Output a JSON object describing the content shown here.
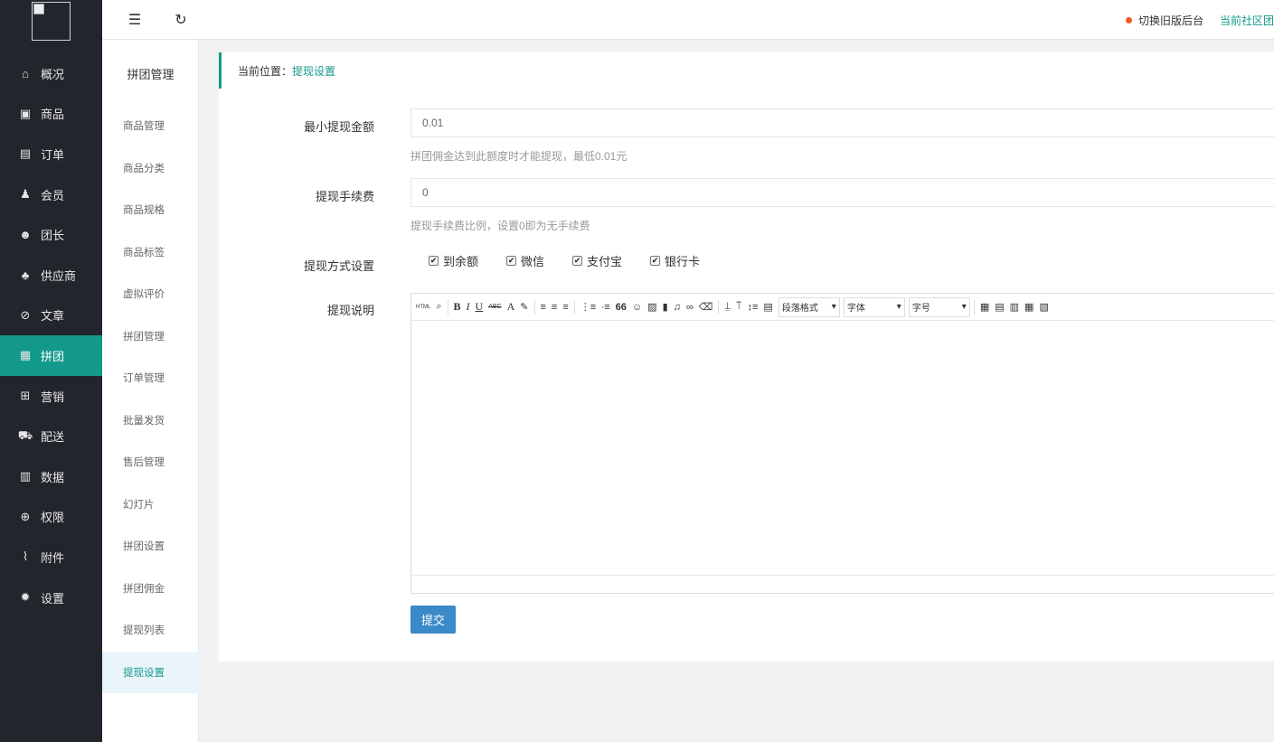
{
  "sidebar": {
    "items": [
      {
        "label": "概况",
        "icon": "home-icon",
        "glyph": "⌂"
      },
      {
        "label": "商品",
        "icon": "product-icon",
        "glyph": "▣"
      },
      {
        "label": "订单",
        "icon": "order-icon",
        "glyph": "▤"
      },
      {
        "label": "会员",
        "icon": "member-icon",
        "glyph": "♟"
      },
      {
        "label": "团长",
        "icon": "leader-icon",
        "glyph": "☻"
      },
      {
        "label": "供应商",
        "icon": "supplier-icon",
        "glyph": "♣"
      },
      {
        "label": "文章",
        "icon": "compass-icon",
        "glyph": "⊘"
      },
      {
        "label": "拼团",
        "icon": "groupbuy-icon",
        "glyph": "▦"
      },
      {
        "label": "营销",
        "icon": "gift-icon",
        "glyph": "⊞"
      },
      {
        "label": "配送",
        "icon": "truck-icon",
        "glyph": "⛟"
      },
      {
        "label": "数据",
        "icon": "chart-icon",
        "glyph": "▥"
      },
      {
        "label": "权限",
        "icon": "lock-icon",
        "glyph": "⊕"
      },
      {
        "label": "附件",
        "icon": "paperclip-icon",
        "glyph": "⌇"
      },
      {
        "label": "设置",
        "icon": "gear-icon",
        "glyph": "✹"
      }
    ],
    "active_index": 7
  },
  "submenu": {
    "title": "拼团管理",
    "items": [
      "商品管理",
      "商品分类",
      "商品规格",
      "商品标签",
      "虚拟评价",
      "拼团管理",
      "订单管理",
      "批量发货",
      "售后管理",
      "幻灯片",
      "拼团设置",
      "拼团佣金",
      "提现列表",
      "提现设置"
    ],
    "active_index": 13
  },
  "topbar": {
    "menu_glyph": "☰",
    "refresh_glyph": "↻",
    "switch_label": "切换旧版后台",
    "community_label": "当前社区团"
  },
  "breadcrumb": {
    "label": "当前位置：",
    "current": "提现设置"
  },
  "form": {
    "min_amount": {
      "label": "最小提现金额",
      "value": "0.01",
      "hint": "拼团佣金达到此额度时才能提现，最低0.01元"
    },
    "fee": {
      "label": "提现手续费",
      "value": "0",
      "hint": "提现手续费比例，设置0即为无手续费"
    },
    "methods": {
      "label": "提现方式设置",
      "options": [
        {
          "label": "到余额",
          "checked": true
        },
        {
          "label": "微信",
          "checked": true
        },
        {
          "label": "支付宝",
          "checked": true
        },
        {
          "label": "银行卡",
          "checked": true
        }
      ]
    },
    "description": {
      "label": "提现说明",
      "toolbar": {
        "html": "HTML",
        "bold": "B",
        "italic": "I",
        "underline": "U",
        "strike": "ABC",
        "font_color": "A",
        "quote": "66",
        "paragraph": "段落格式",
        "font": "字体",
        "size": "字号"
      }
    },
    "submit_label": "提交"
  },
  "colors": {
    "sidebar_bg": "#22252b",
    "accent": "#13998a",
    "button": "#3c89c7",
    "dot": "#f05a28"
  }
}
